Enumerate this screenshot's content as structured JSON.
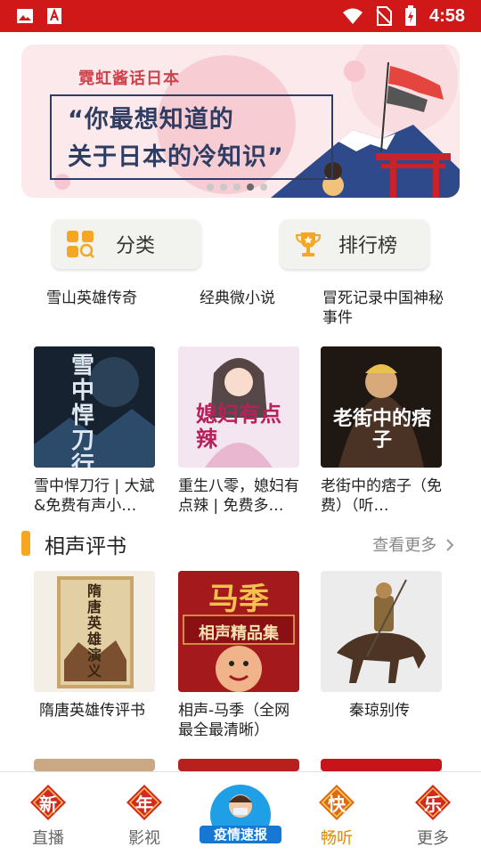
{
  "status_bar": {
    "time": "4:58",
    "icons": [
      "image-icon",
      "app-icon",
      "wifi-icon",
      "no-sim-icon",
      "battery-charging-icon"
    ]
  },
  "banner": {
    "tag": "霓虹酱话日本",
    "line1": "“你最想知道的",
    "line2": "关于日本的冷知识”",
    "slides": 5,
    "active_slide": 3
  },
  "quick_buttons": {
    "category": "分类",
    "ranking": "排行榜"
  },
  "top_row_titles": [
    "雪山英雄传奇",
    "经典微小说",
    "冒死记录中国神秘事件"
  ],
  "novels": [
    {
      "title": "雪中悍刀行 | 大斌&免费有声小…",
      "cover_text": "雪中悍刀行"
    },
    {
      "title": "重生八零，媳妇有点辣 | 免费多…",
      "cover_text": "媳妇有点辣"
    },
    {
      "title": "老街中的痞子（免费）（听…",
      "cover_text": "老街中的痞子"
    }
  ],
  "section": {
    "title": "相声评书",
    "more": "查看更多"
  },
  "crosstalk": [
    {
      "title": "隋唐英雄传评书",
      "cover_text": "隋唐英雄演义"
    },
    {
      "title": "相声-马季（全网最全最清晰）",
      "cover_text_1": "马季",
      "cover_text_2": "相声精品集"
    },
    {
      "title": "秦琼别传"
    }
  ],
  "bottom_nav": [
    {
      "badge": "新",
      "label": "直播"
    },
    {
      "badge": "年",
      "label": "影视"
    },
    {
      "badge": "疫情速报",
      "label": ""
    },
    {
      "badge": "快",
      "label": "畅听"
    },
    {
      "badge": "乐",
      "label": "更多"
    }
  ],
  "colors": {
    "status_bar": "#d01818",
    "accent": "#f5a623",
    "nav_active": "#e08a00"
  }
}
